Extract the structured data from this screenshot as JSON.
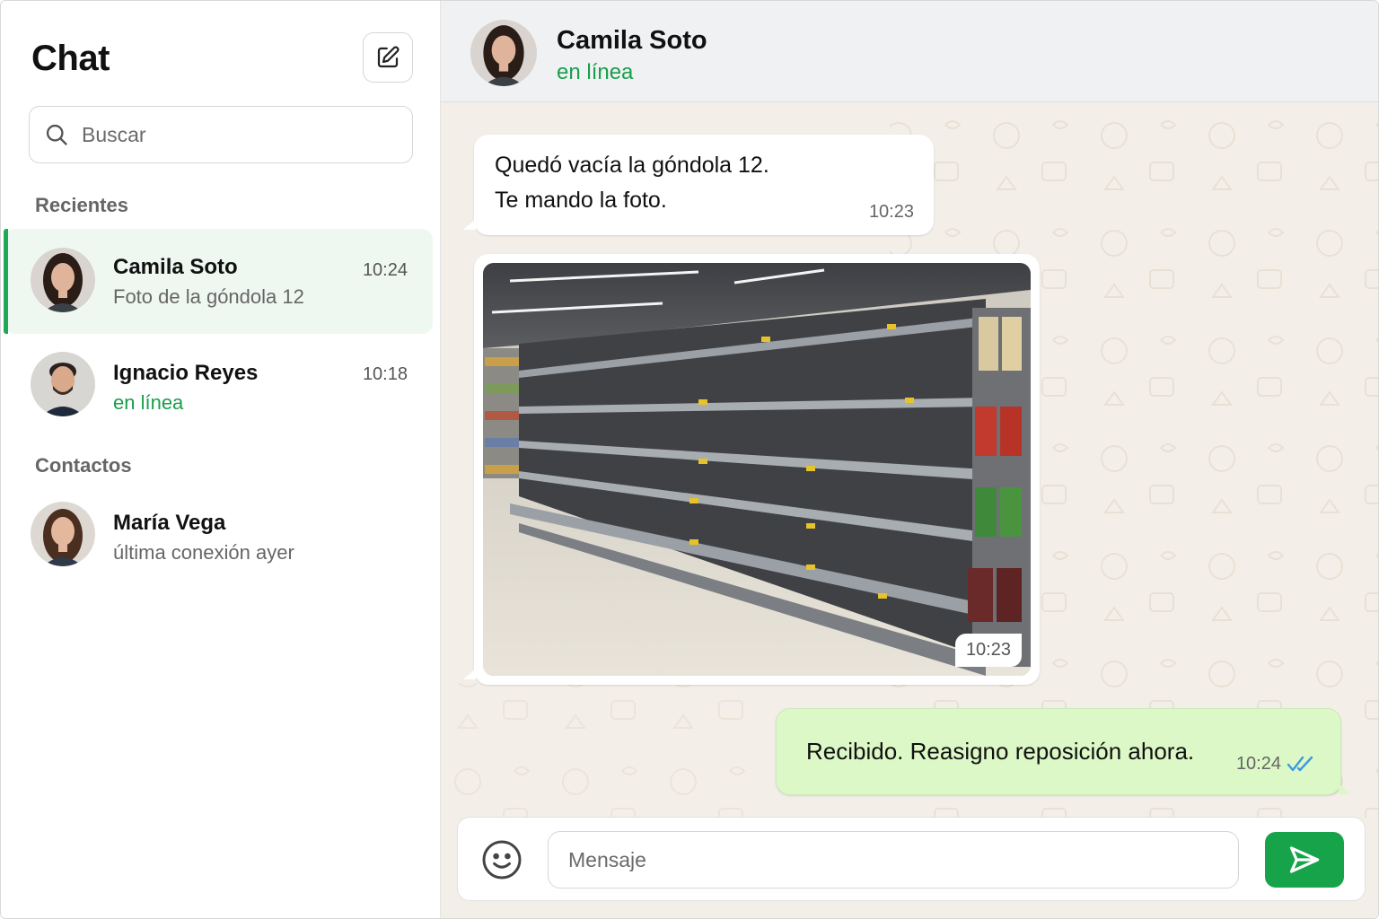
{
  "sidebar": {
    "title": "Chat",
    "compose_icon": "compose-icon",
    "search": {
      "placeholder": "Buscar",
      "icon": "search-icon"
    },
    "recent_label": "Recientes",
    "contacts_label": "Contactos",
    "recent": [
      {
        "name": "Camila Soto",
        "preview": "Foto de la góndola 12",
        "time": "10:24",
        "active": true
      },
      {
        "name": "Ignacio Reyes",
        "preview": "en línea",
        "time": "10:18",
        "active": false
      }
    ],
    "contacts": [
      {
        "name": "María Vega",
        "status": "última conexión ayer"
      }
    ]
  },
  "conversation": {
    "contact_name": "Camila Soto",
    "contact_status": "en línea",
    "messages": [
      {
        "direction": "in",
        "lines": [
          "Quedó vacía la góndola 12.",
          "Te mando la foto."
        ],
        "time": "10:23"
      },
      {
        "direction": "in",
        "type": "image",
        "time": "10:23"
      },
      {
        "direction": "out",
        "text": "Recibido. Reasigno reposición ahora.",
        "time": "10:24",
        "read": true
      }
    ]
  },
  "composer": {
    "placeholder": "Mensaje",
    "emoji_icon": "emoji-icon",
    "send_icon": "send-icon"
  },
  "colors": {
    "accent": "#16a34a",
    "online": "#1a9e4b",
    "outgoing_bubble": "#dcf8c6",
    "read_ticks": "#3b9ae1",
    "chat_background": "#f3efe8"
  }
}
